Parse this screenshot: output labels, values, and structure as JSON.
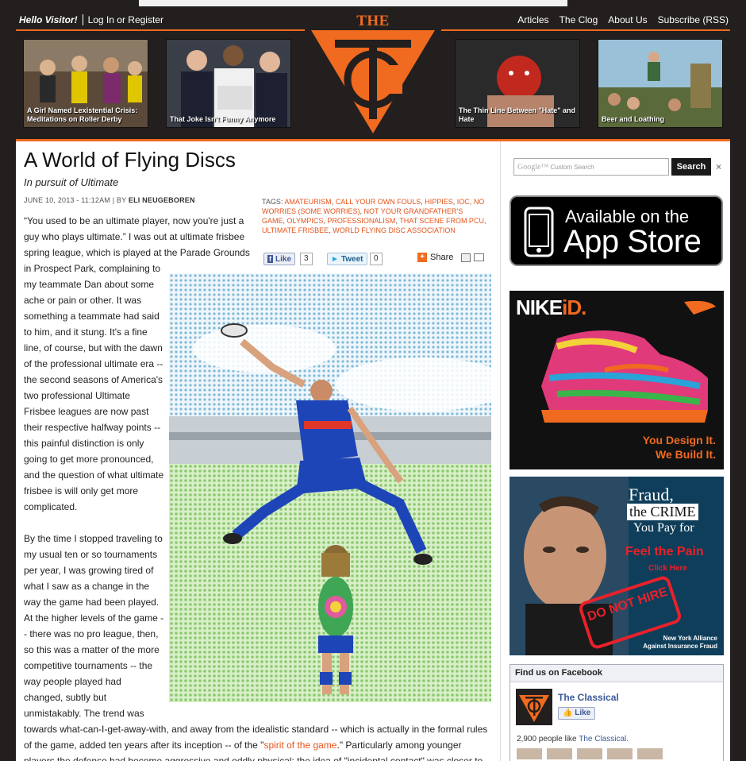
{
  "header": {
    "greeting": "Hello Visitor!",
    "login": "Log In or Register",
    "nav": [
      "Articles",
      "The Clog",
      "About Us",
      "Subscribe (RSS)"
    ],
    "logo_text": "THE CLASSICAL"
  },
  "features": [
    {
      "caption": "A Girl Named Lexistential Crisis: Meditations on Roller Derby"
    },
    {
      "caption": "That Joke Isn't Funny Anymore"
    },
    {
      "caption": "The Thin Line Between \"Hate\" and Hate"
    },
    {
      "caption": "Beer and Loathing"
    }
  ],
  "article": {
    "title": "A World of Flying Discs",
    "subtitle": "In pursuit of Ultimate",
    "date": "JUNE 10, 2013 - 11:12AM | BY ",
    "author": "ELI NEUGEBOREN",
    "tags_label": "TAGS: ",
    "tags": [
      "AMATEURISM",
      "CALL YOUR OWN FOULS",
      "HIPPIES",
      "IOC",
      "NO WORRIES (SOME WORRIES)",
      "NOT YOUR GRANDFATHER'S GAME",
      "OLYMPICS",
      "PROFESSIONALISM",
      "THAT SCENE FROM PCU",
      "ULTIMATE FRISBEE",
      "WORLD FLYING DISC ASSOCIATION"
    ],
    "social": {
      "like": "Like",
      "like_count": "3",
      "tweet": "Tweet",
      "tweet_count": "0",
      "share": "Share"
    },
    "para1": [
      "“You used to be an ultimate player, now you're just a",
      "guy who plays ultimate.” I was out at ultimate frisbee",
      "spring league, which is played at the Parade Grounds",
      "in Prospect Park, complaining to",
      "my teammate Dan about some",
      "ache or pain or other. It was",
      "something a teammate had said",
      "to him, and it stung. It's a fine",
      "line, of course, but with the dawn",
      "of the professional ultimate era --",
      "the second seasons of America's",
      "two professional Ultimate",
      "Frisbee leagues are now past",
      "their respective halfway points --",
      "this painful distinction is only",
      "going to get more pronounced,",
      "and the question of what ultimate",
      "frisbee is will only get more",
      "complicated."
    ],
    "para2": [
      "By the time I stopped traveling to",
      "my usual ten or so tournaments",
      "per year, I was growing tired of",
      "what I saw as a change in the",
      "way the game had been played.",
      "At the higher levels of the game -",
      "- there was no pro league, then,",
      "so this was a matter of the more",
      "competitive tournaments -- the",
      "way people played had",
      "changed, subtly but",
      "unmistakably. The trend was"
    ],
    "para2_full1": "towards what-can-I-get-away-with, and away from the idealistic standard -- which is actually in the formal rules",
    "para2_full2_pre": "of the game, added ten years after its inception -- of the \"",
    "para2_link": "spirit of the game",
    "para2_full2_post": ".\" Particularly among younger",
    "para2_full3": "players the defense had become aggressive and oddly physical; the idea of \"incidental contact\" was closer to"
  },
  "sidebar": {
    "search_placeholder": "Custom Search",
    "search_google": "Google™",
    "search_button": "Search",
    "search_clear": "×",
    "appstore_line1": "Available on the",
    "appstore_line2": "App Store",
    "nike_title_a": "NIKE",
    "nike_title_b": "iD.",
    "nike_cta1": "You Design It.",
    "nike_cta2": "We Build It.",
    "fraud_line1": "Fraud,",
    "fraud_line2": "the CRIME",
    "fraud_line3": "You Pay for",
    "fraud_pain": "Feel the Pain",
    "fraud_click": "Click Here",
    "fraud_stamp": "DO NOT HIRE",
    "fraud_org1": "New York Alliance",
    "fraud_org2": "Against Insurance Fraud",
    "fb_header": "Find us on Facebook",
    "fb_name": "The Classical",
    "fb_like": "Like",
    "fb_count_pre": "2,900 people like ",
    "fb_count_link": "The Classical",
    "fb_count_post": "."
  }
}
